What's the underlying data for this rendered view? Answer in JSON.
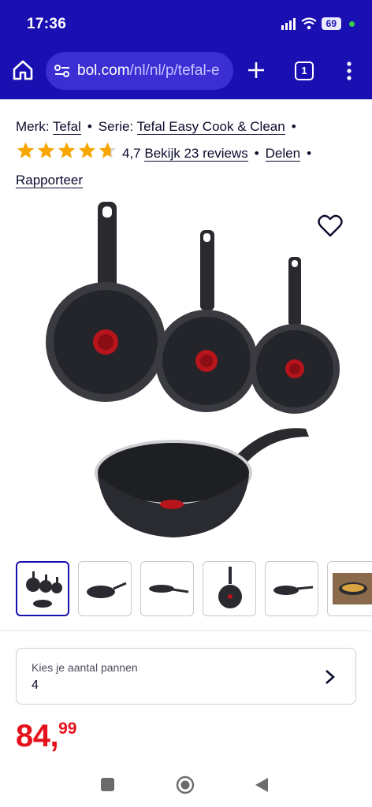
{
  "status": {
    "time": "17:36",
    "battery": "69"
  },
  "browser": {
    "url_host": "bol.com",
    "url_path": "/nl/nl/p/tefal-e",
    "tab_count": "1"
  },
  "product": {
    "brand_label": "Merk:",
    "brand": "Tefal",
    "series_label": "Serie:",
    "series": "Tefal Easy Cook & Clean",
    "rating": "4,7",
    "reviews_link": "Bekijk 23 reviews",
    "share_link": "Delen",
    "report_link": "Rapporteer",
    "star_count": 5,
    "rating_value": 4.7
  },
  "options": {
    "label": "Kies je aantal pannen",
    "value": "4"
  },
  "price": {
    "main": "84,",
    "cents": "99"
  },
  "colors": {
    "brand_blue": "#1a0fb0",
    "price_red": "#e5121d",
    "star": "#f7a600"
  }
}
